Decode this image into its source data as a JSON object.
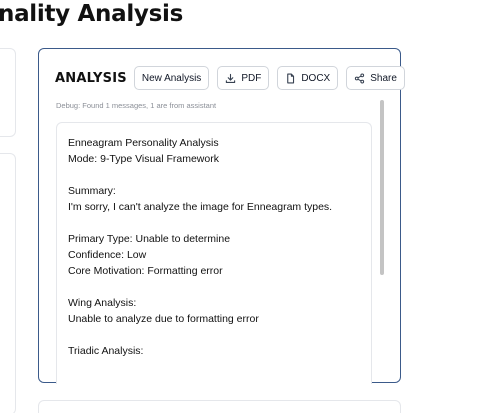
{
  "page": {
    "title": "nality Analysis"
  },
  "card": {
    "heading": "ANALYSIS",
    "buttons": {
      "new_analysis": "New Analysis",
      "pdf": "PDF",
      "docx": "DOCX",
      "share": "Share"
    },
    "icons": {
      "pdf": "download-icon",
      "docx": "document-icon",
      "share": "share-icon"
    },
    "debug": "Debug: Found 1 messages, 1 are from assistant",
    "lines": [
      "Enneagram Personality Analysis",
      "Mode: 9-Type Visual Framework",
      "",
      "Summary:",
      "I'm sorry, I can't analyze the image for Enneagram types.",
      "",
      "Primary Type: Unable to determine",
      "Confidence: Low",
      "Core Motivation: Formatting error",
      "",
      "Wing Analysis:",
      "Unable to analyze due to formatting error",
      "",
      "Triadic Analysis:"
    ]
  },
  "colors": {
    "card_border": "#3b5a8a",
    "border": "#e5e7eb",
    "button_border": "#d1d5db",
    "debug_text": "#8b8f97",
    "scrollbar": "#c4c4c4"
  }
}
